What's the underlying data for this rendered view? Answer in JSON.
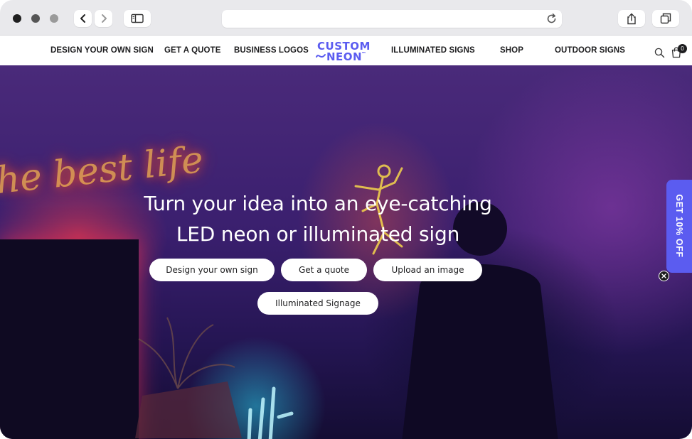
{
  "browser": {
    "address_text": "",
    "buttons": [
      "back",
      "forward",
      "sidebar",
      "reload",
      "share",
      "tabs"
    ]
  },
  "nav": {
    "links": [
      "DESIGN YOUR OWN SIGN",
      "GET A QUOTE",
      "BUSINESS LOGOS",
      "ILLUMINATED SIGNS",
      "SHOP",
      "OUTDOOR SIGNS"
    ],
    "logo_line1": "CUSTOM",
    "logo_line2": "NEON",
    "logo_tm": "™",
    "cart_count": "0"
  },
  "hero": {
    "headline_line1": "Turn your idea into an eye-catching",
    "headline_line2": "LED neon or illuminated sign",
    "buttons": [
      "Design your own sign",
      "Get a quote",
      "Upload an image",
      "Illuminated Signage"
    ],
    "background_neon_text": "he best life"
  },
  "promo": {
    "tab_label": "GET 10% OFF"
  },
  "colors": {
    "brand": "#5b5cf0",
    "chrome_bg": "#e9e9ec",
    "text_dark": "#1d1d1f"
  }
}
